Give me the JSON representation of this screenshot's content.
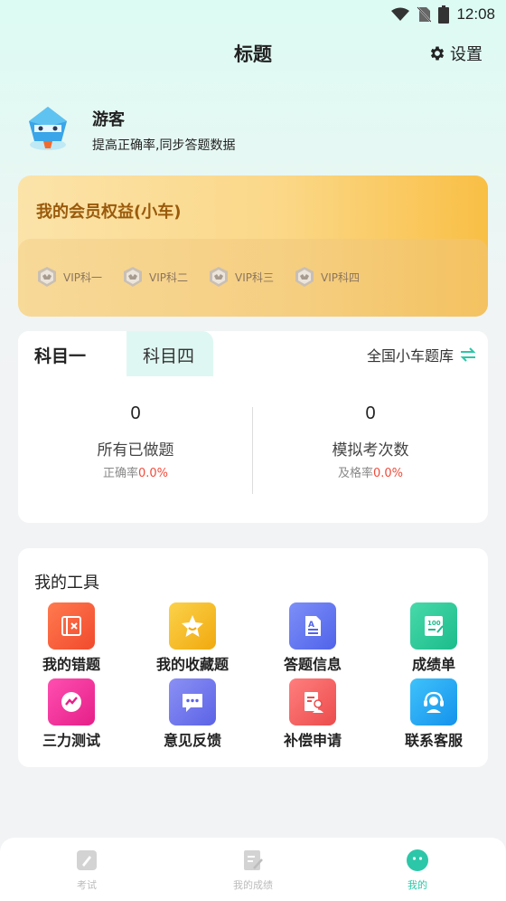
{
  "status": {
    "time": "12:08"
  },
  "header": {
    "title": "标题",
    "settings_label": "设置"
  },
  "profile": {
    "name": "游客",
    "subtitle": "提高正确率,同步答题数据"
  },
  "vip": {
    "title": "我的会员权益(小车)",
    "badges": [
      {
        "label": "VIP科一"
      },
      {
        "label": "VIP科二"
      },
      {
        "label": "VIP科三"
      },
      {
        "label": "VIP科四"
      }
    ]
  },
  "subjects": {
    "tabs": [
      {
        "label": "科目一"
      },
      {
        "label": "科目四"
      }
    ],
    "bank_label": "全国小车题库",
    "stats": [
      {
        "value": "0",
        "label": "所有已做题",
        "rate_label": "正确率",
        "rate_value": "0.0%"
      },
      {
        "value": "0",
        "label": "模拟考次数",
        "rate_label": "及格率",
        "rate_value": "0.0%"
      }
    ]
  },
  "tools": {
    "title": "我的工具",
    "items": [
      {
        "label": "我的错题",
        "icon": "wrong-questions-icon",
        "color": "#f75a3b"
      },
      {
        "label": "我的收藏题",
        "icon": "favorites-icon",
        "color": "#f5b81d"
      },
      {
        "label": "答题信息",
        "icon": "answer-info-icon",
        "color": "#6177f2"
      },
      {
        "label": "成绩单",
        "icon": "score-report-icon",
        "color": "#2ccb9c"
      },
      {
        "label": "三力测试",
        "icon": "three-ability-test-icon",
        "color": "#f0339a"
      },
      {
        "label": "意见反馈",
        "icon": "feedback-icon",
        "color": "#7077ee"
      },
      {
        "label": "补偿申请",
        "icon": "compensation-icon",
        "color": "#f56565"
      },
      {
        "label": "联系客服",
        "icon": "customer-service-icon",
        "color": "#1ea8f5"
      }
    ]
  },
  "nav": {
    "items": [
      {
        "label": "考试",
        "icon": "exam-icon"
      },
      {
        "label": "我的成绩",
        "icon": "my-scores-icon"
      },
      {
        "label": "我的",
        "icon": "mine-icon"
      }
    ],
    "active_color": "#2cc7a8"
  }
}
